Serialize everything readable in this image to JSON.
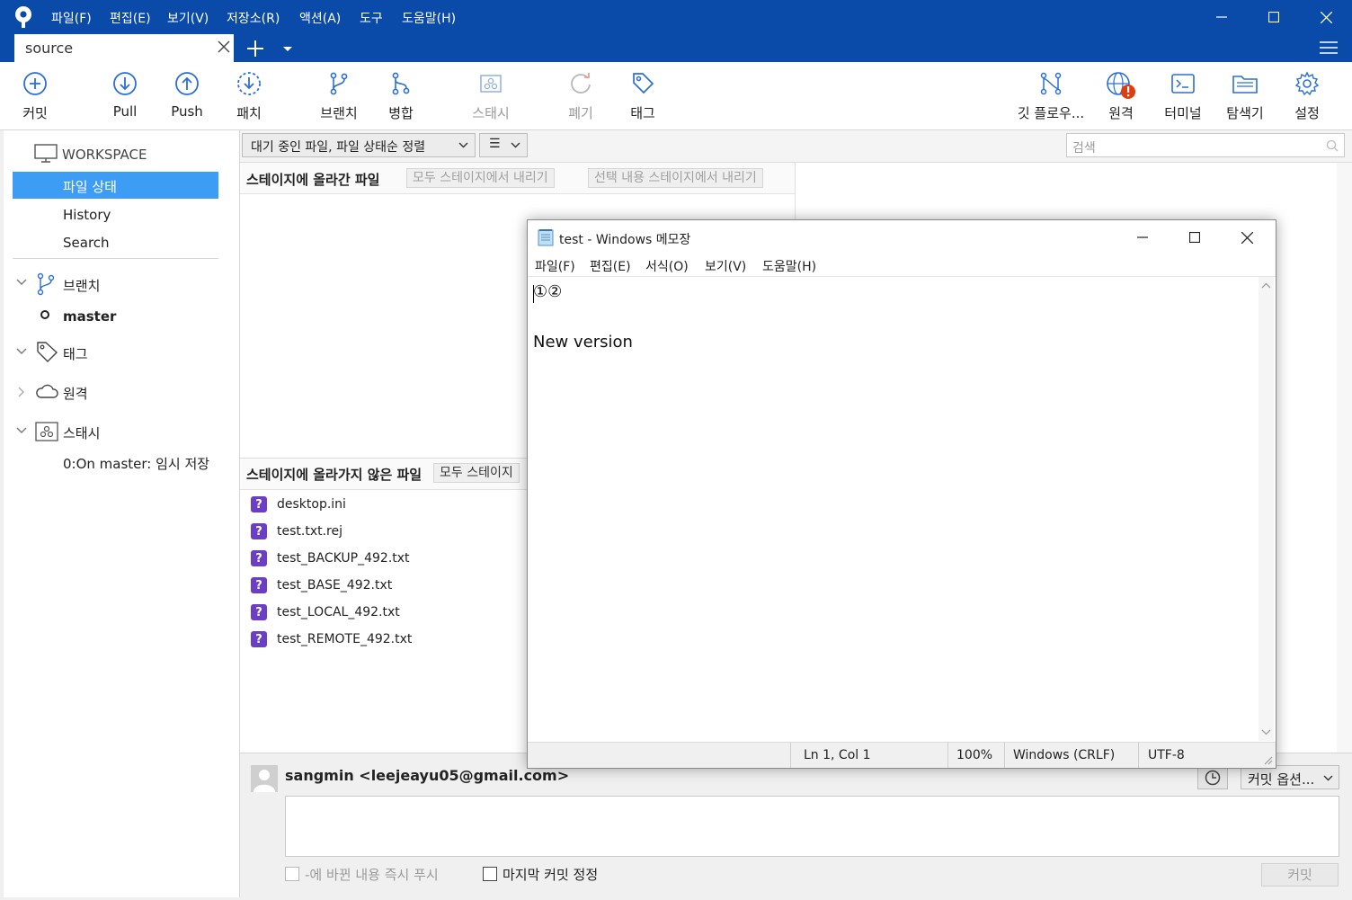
{
  "menu": [
    "파일(F)",
    "편집(E)",
    "보기(V)",
    "저장소(R)",
    "액션(A)",
    "도구",
    "도움말(H)"
  ],
  "tab": {
    "label": "source"
  },
  "toolbar": {
    "commit": "커밋",
    "pull": "Pull",
    "push": "Push",
    "patch": "패치",
    "branch": "브랜치",
    "merge": "병합",
    "stash": "스태시",
    "discard": "폐기",
    "tag": "태그",
    "gitflow": "깃 플로우...",
    "remote": "원격",
    "terminal": "터미널",
    "explorer": "탐색기",
    "settings": "설정"
  },
  "sidebar": {
    "workspace": "WORKSPACE",
    "file_status": "파일 상태",
    "history": "History",
    "search": "Search",
    "branches": "브랜치",
    "current_branch": "master",
    "tags": "태그",
    "remotes": "원격",
    "stashes": "스태시",
    "stash_item": "0:On master: 임시 저장"
  },
  "filter": {
    "sort": "대기 중인 파일, 파일 상태순 정렬",
    "view": "☰",
    "search_placeholder": "검색"
  },
  "staged": {
    "title": "스테이지에 올라간 파일",
    "unstage_all": "모두 스테이지에서 내리기",
    "unstage_selected": "선택 내용 스테이지에서 내리기"
  },
  "unstaged": {
    "title": "스테이지에 올라가지 않은 파일",
    "stage_all": "모두 스테이지",
    "files": [
      "desktop.ini",
      "test.txt.rej",
      "test_BACKUP_492.txt",
      "test_BASE_492.txt",
      "test_LOCAL_492.txt",
      "test_REMOTE_492.txt"
    ]
  },
  "commit_area": {
    "author": "sangmin <leejeayu05@gmail.com>",
    "options": "커밋 옵션...",
    "push_immediately": "-에 바뀐 내용 즉시 푸시",
    "amend": "마지막 커밋 정정",
    "commit_button": "커밋"
  },
  "notepad": {
    "title": "test - Windows 메모장",
    "menu": [
      "파일(F)",
      "편집(E)",
      "서식(O)",
      "보기(V)",
      "도움말(H)"
    ],
    "content": "①②\n\nNew version",
    "status": {
      "position": "Ln 1, Col 1",
      "zoom": "100%",
      "line_ending": "Windows (CRLF)",
      "encoding": "UTF-8"
    }
  },
  "colors": {
    "titlebar": "#0a4aa8",
    "selection": "#3d9df5",
    "file_unknown": "#6a3fc4",
    "remote_alert": "#e03c0f"
  }
}
